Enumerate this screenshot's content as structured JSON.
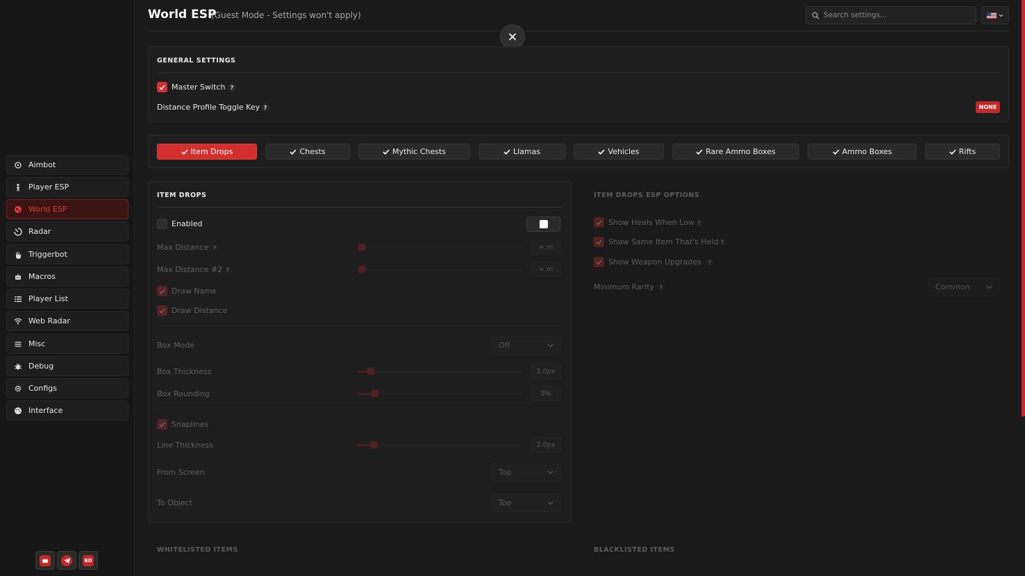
{
  "header": {
    "title": "World ESP",
    "subtitle": "(Guest Mode - Settings won't apply)",
    "search_placeholder": "Search settings..."
  },
  "sidebar": {
    "items": [
      {
        "label": "Aimbot",
        "icon": "crosshair-icon"
      },
      {
        "label": "Player ESP",
        "icon": "person-icon"
      },
      {
        "label": "World ESP",
        "icon": "globe-icon",
        "active": true
      },
      {
        "label": "Radar",
        "icon": "radar-icon"
      },
      {
        "label": "Triggerbot",
        "icon": "hand-icon"
      },
      {
        "label": "Macros",
        "icon": "robot-icon"
      },
      {
        "label": "Player List",
        "icon": "list-icon"
      },
      {
        "label": "Web Radar",
        "icon": "wifi-icon"
      },
      {
        "label": "Misc",
        "icon": "menu-icon"
      },
      {
        "label": "Debug",
        "icon": "bug-icon"
      },
      {
        "label": "Configs",
        "icon": "gear-icon"
      },
      {
        "label": "Interface",
        "icon": "palette-icon"
      }
    ],
    "social": [
      {
        "name": "discord-icon",
        "label": ""
      },
      {
        "name": "telegram-icon",
        "label": ""
      },
      {
        "name": "bd-logo-icon",
        "label": "BD"
      }
    ]
  },
  "general": {
    "title": "GENERAL SETTINGS",
    "master_switch": "Master Switch",
    "master_checked": true,
    "toggle_key_label": "Distance Profile Toggle Key",
    "toggle_key_value": "NONE",
    "help": "?"
  },
  "tabs": [
    "Item Drops",
    "Chests",
    "Mythic Chests",
    "Llamas",
    "Vehicles",
    "Rare Ammo Boxes",
    "Ammo Boxes",
    "Rifts"
  ],
  "item_drops": {
    "title": "ITEM DROPS",
    "enabled": "Enabled",
    "max_distance": "Max Distance",
    "max_distance_value": "∞ m",
    "max_distance2": "Max Distance #2",
    "max_distance2_value": "∞ m",
    "draw_name": "Draw Name",
    "draw_distance": "Draw Distance",
    "box_mode": "Box Mode",
    "box_mode_value": "Off",
    "box_thickness": "Box Thickness",
    "box_thickness_value": "1.0px",
    "box_rounding": "Box Rounding",
    "box_rounding_value": "8%",
    "snaplines": "Snaplines",
    "line_thickness": "Line Thickness",
    "line_thickness_value": "2.0px",
    "from_screen": "From Screen",
    "from_screen_value": "Top",
    "to_object": "To Object",
    "to_object_value": "Top"
  },
  "esp_options": {
    "title": "ITEM DROPS ESP OPTIONS",
    "heals": "Show Heals When Low",
    "same_item": "Show Same Item That's Held",
    "weapon_upgrades": "Show Weapon Upgrades",
    "min_rarity": "Minimum Rarity",
    "min_rarity_value": "Common"
  },
  "whitelisted": "WHITELISTED ITEMS",
  "blacklisted": "BLACKLISTED ITEMS",
  "colors": {
    "accent": "#d32f2f",
    "bg": "#1a1a1a"
  }
}
